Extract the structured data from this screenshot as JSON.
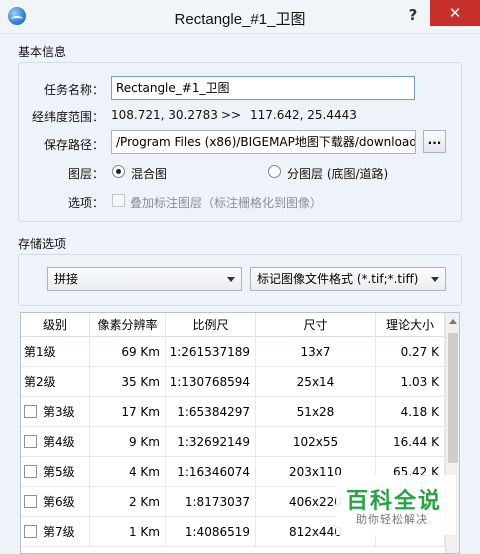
{
  "window": {
    "title": "Rectangle_#1_卫图",
    "help": "?",
    "close": "✕"
  },
  "basic": {
    "section": "基本信息",
    "task_label": "任务名称：",
    "task_value": "Rectangle_#1_卫图",
    "range_label": "经纬度范围：",
    "range_from": "108.721, 30.2783",
    "range_arrow": ">>",
    "range_to": "117.642, 25.4443",
    "path_label": "保存路径：",
    "path_value": "/Program Files (x86)/BIGEMAP地图下载器/download",
    "browse": "...",
    "layer_label": "图层：",
    "layer_options": [
      "混合图",
      "分图层 (底图/道路)"
    ],
    "layer_selected": 0,
    "options_label": "选项：",
    "overlay_option": "叠加标注图层（标注栅格化到图像）"
  },
  "storage": {
    "section": "存储选项",
    "mode": "拼接",
    "format": "标记图像文件格式 (*.tif;*.tiff)"
  },
  "table": {
    "headers": [
      "级别",
      "像素分辨率",
      "比例尺",
      "尺寸",
      "理论大小"
    ],
    "rows": [
      {
        "level": "第1级",
        "checkbox": false,
        "res": "69 Km",
        "scale": "1:261537189",
        "size": "13x7",
        "est": "0.27 K"
      },
      {
        "level": "第2级",
        "checkbox": false,
        "res": "35 Km",
        "scale": "1:130768594",
        "size": "25x14",
        "est": "1.03 K"
      },
      {
        "level": "第3级",
        "checkbox": true,
        "res": "17 Km",
        "scale": "1:65384297",
        "size": "51x28",
        "est": "4.18 K"
      },
      {
        "level": "第4级",
        "checkbox": true,
        "res": "9 Km",
        "scale": "1:32692149",
        "size": "102x55",
        "est": "16.44 K"
      },
      {
        "level": "第5级",
        "checkbox": true,
        "res": "4 Km",
        "scale": "1:16346074",
        "size": "203x110",
        "est": "65.42 K"
      },
      {
        "level": "第6级",
        "checkbox": true,
        "res": "2 Km",
        "scale": "1:8173037",
        "size": "406x220",
        "est": ""
      },
      {
        "level": "第7级",
        "checkbox": true,
        "res": "1 Km",
        "scale": "1:4086519",
        "size": "812x440",
        "est": ""
      }
    ]
  },
  "watermark": {
    "logo": "百科全说",
    "sub": "助你轻松解决"
  },
  "colors": {
    "close": "#c7312b",
    "watermark": "#27a343"
  }
}
